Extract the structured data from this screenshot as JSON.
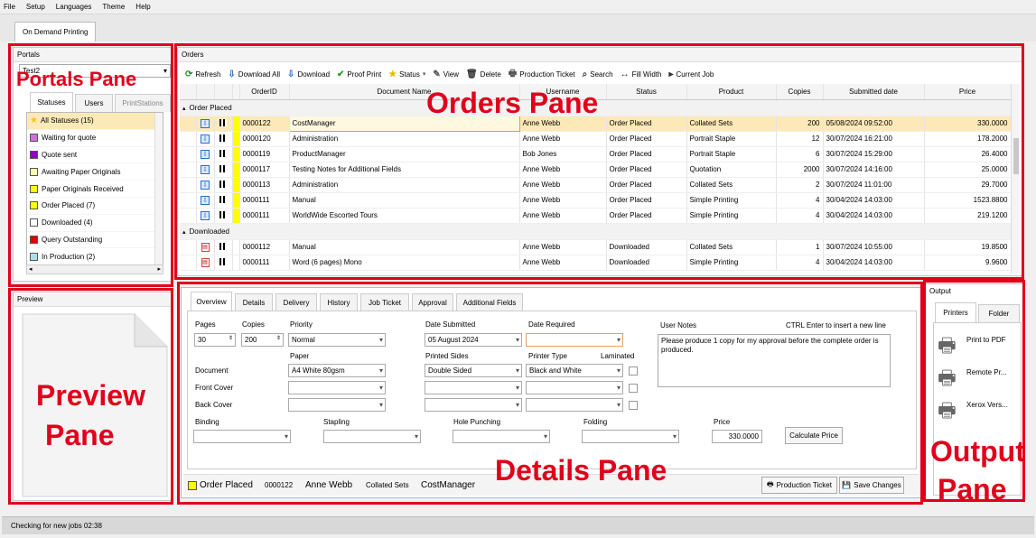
{
  "menu": [
    "File",
    "Setup",
    "Languages",
    "Theme",
    "Help"
  ],
  "doc_tab": "On Demand Printing",
  "portals": {
    "header": "Portals",
    "selected": "Test2",
    "tabs": [
      "Statuses",
      "Users",
      "PrintStations"
    ],
    "statuses": [
      {
        "label": "All Statuses (15)",
        "color": "#f5c518",
        "star": true
      },
      {
        "label": "Waiting for quote",
        "color": "#d070e0"
      },
      {
        "label": "Quote sent",
        "color": "#8a00c8"
      },
      {
        "label": "Awaiting Paper Originals",
        "color": "#fffbb0"
      },
      {
        "label": "Paper Originals Received",
        "color": "#ffff00"
      },
      {
        "label": "Order Placed (7)",
        "color": "#ffff00"
      },
      {
        "label": "Downloaded (4)",
        "color": "#ffffff"
      },
      {
        "label": "Query Outstanding",
        "color": "#e00000"
      },
      {
        "label": "In Production (2)",
        "color": "#a8e0e8"
      }
    ]
  },
  "preview": {
    "header": "Preview"
  },
  "orders": {
    "header": "Orders",
    "toolbar": [
      "Refresh",
      "Download All",
      "Download",
      "Proof Print",
      "Status",
      "View",
      "Delete",
      "Production Ticket",
      "Search",
      "Fill Width",
      "Current Job"
    ],
    "columns": [
      "OrderID",
      "Document Name",
      "Username",
      "Status",
      "Product",
      "Copies",
      "Submitted date",
      "Price"
    ],
    "groups": [
      {
        "label": "Order Placed",
        "rows": [
          {
            "id": "0000122",
            "doc": "CostManager",
            "user": "Anne Webb",
            "status": "Order Placed",
            "product": "Collated Sets",
            "copies": "200",
            "date": "05/08/2024 09:52:00",
            "price": "330.0000"
          },
          {
            "id": "0000120",
            "doc": "Administration",
            "user": "Anne Webb",
            "status": "Order Placed",
            "product": "Portrait Staple",
            "copies": "12",
            "date": "30/07/2024 16:21:00",
            "price": "178.2000"
          },
          {
            "id": "0000119",
            "doc": "ProductManager",
            "user": "Bob Jones",
            "status": "Order Placed",
            "product": "Portrait Staple",
            "copies": "6",
            "date": "30/07/2024 15:29:00",
            "price": "26.4000"
          },
          {
            "id": "0000117",
            "doc": "Testing Notes for Additional Fields",
            "user": "Anne Webb",
            "status": "Order Placed",
            "product": "Quotation",
            "copies": "2000",
            "date": "30/07/2024 14:16:00",
            "price": "25.0000"
          },
          {
            "id": "0000113",
            "doc": "Administration",
            "user": "Anne Webb",
            "status": "Order Placed",
            "product": "Collated Sets",
            "copies": "2",
            "date": "30/07/2024 11:01:00",
            "price": "29.7000"
          },
          {
            "id": "0000111",
            "doc": "Manual",
            "user": "Anne Webb",
            "status": "Order Placed",
            "product": "Simple Printing",
            "copies": "4",
            "date": "30/04/2024 14:03:00",
            "price": "1523.8800"
          },
          {
            "id": "0000111",
            "doc": "WorldWide Escorted Tours",
            "user": "Anne Webb",
            "status": "Order Placed",
            "product": "Simple Printing",
            "copies": "4",
            "date": "30/04/2024 14:03:00",
            "price": "219.1200"
          }
        ]
      },
      {
        "label": "Downloaded",
        "rows": [
          {
            "id": "0000112",
            "doc": "Manual",
            "user": "Anne Webb",
            "status": "Downloaded",
            "product": "Collated Sets",
            "copies": "1",
            "date": "30/07/2024 10:55:00",
            "price": "19.8500"
          },
          {
            "id": "0000111",
            "doc": "Word (6 pages) Mono",
            "user": "Anne Webb",
            "status": "Downloaded",
            "product": "Simple Printing",
            "copies": "4",
            "date": "30/04/2024 14:03:00",
            "price": "9.9600"
          }
        ]
      }
    ]
  },
  "details": {
    "tabs": [
      "Overview",
      "Details",
      "Delivery",
      "History",
      "Job Ticket",
      "Approval",
      "Additional Fields"
    ],
    "labels": {
      "pages": "Pages",
      "copies": "Copies",
      "priority": "Priority",
      "date_submitted": "Date Submitted",
      "date_required": "Date Required",
      "user_notes": "User Notes",
      "ctrl_hint": "CTRL Enter to insert a new line",
      "paper": "Paper",
      "printed_sides": "Printed Sides",
      "printer_type": "Printer Type",
      "laminated": "Laminated",
      "document": "Document",
      "front_cover": "Front Cover",
      "back_cover": "Back Cover",
      "binding": "Binding",
      "stapling": "Stapling",
      "hole_punching": "Hole Punching",
      "folding": "Folding",
      "price": "Price"
    },
    "values": {
      "pages": "30",
      "copies": "200",
      "priority": "Normal",
      "date_submitted": "05 August 2024",
      "paper": "A4 White 80gsm",
      "printed_sides": "Double Sided",
      "printer_type": "Black and White",
      "price": "330.0000",
      "notes": "Please produce 1 copy for my approval before the complete order is produced."
    },
    "calc_button": "Calculate Price",
    "footer": {
      "status": "Order Placed",
      "id": "0000122",
      "user": "Anne Webb",
      "product": "Collated Sets",
      "doc": "CostManager",
      "ticket_button": "Production Ticket",
      "save_button": "Save Changes"
    }
  },
  "output": {
    "header": "Output",
    "tabs": [
      "Printers",
      "Folder"
    ],
    "printers": [
      "Print to PDF",
      "Remote Pr...",
      "Xerox Vers..."
    ]
  },
  "statusbar": "Checking for new jobs  02:38",
  "annotations": {
    "portals": "Portals Pane",
    "orders": "Orders Pane",
    "preview_1": "Preview",
    "preview_2": "Pane",
    "details": "Details Pane",
    "output_1": "Output",
    "output_2": "Pane"
  }
}
